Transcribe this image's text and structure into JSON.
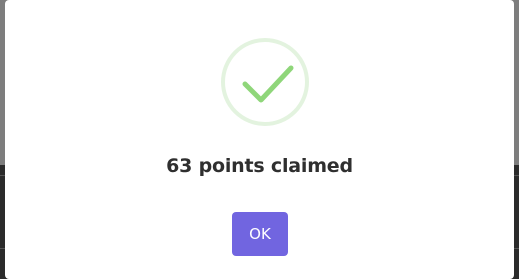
{
  "dialog": {
    "title": "63 points claimed",
    "ok_label": "OK",
    "icon": "checkmark-success-icon"
  },
  "colors": {
    "accent": "#7165e0",
    "success_check": "#8fd67a",
    "success_ring": "#e3f3df"
  }
}
